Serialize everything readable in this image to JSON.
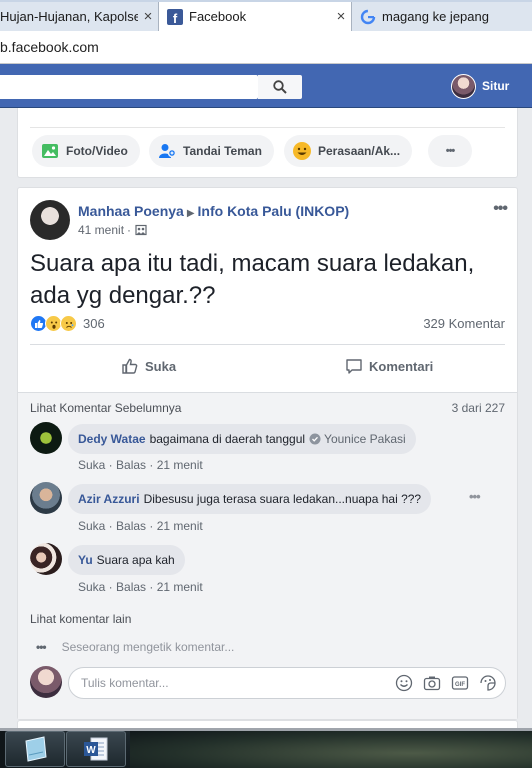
{
  "browser": {
    "tabs": [
      {
        "label": "Hujan-Hujanan, Kapolsek",
        "close": "×"
      },
      {
        "label": "Facebook",
        "close": "×"
      },
      {
        "label": "magang ke jepang",
        "close": "×"
      }
    ],
    "url": "b.facebook.com"
  },
  "header": {
    "user_name": "Situr"
  },
  "composer": {
    "actions": [
      {
        "label": "Foto/Video"
      },
      {
        "label": "Tandai Teman"
      },
      {
        "label": "Perasaan/Ak..."
      },
      {
        "label": "•••"
      }
    ]
  },
  "post": {
    "author": "Manhaa Poenya",
    "arrow": "▶",
    "group": "Info Kota Palu (INKOP)",
    "time": "41 menit",
    "separator": "·",
    "text": "Suara apa itu tadi, macam suara ledakan, ada yg dengar.??",
    "reaction_count": "306",
    "comment_count": "329 Komentar",
    "more": "•••",
    "actions": {
      "like": "Suka",
      "comment": "Komentari"
    }
  },
  "comments": {
    "prev_link": "Lihat Komentar Sebelumnya",
    "pager": "3 dari 227",
    "items": [
      {
        "name": "Dedy Watae",
        "text": "bagaimana di daerah tanggul",
        "tag": "Younice Pakasi",
        "actions": "Suka · Balas · 21 menit"
      },
      {
        "name": "Azir Azzuri",
        "text": "Dibesusu juga terasa suara ledakan...nuapa hai ???",
        "actions": "Suka · Balas · 21 menit"
      },
      {
        "name": "Yu",
        "text": "Suara apa kah",
        "actions": "Suka · Balas · 21 menit"
      }
    ],
    "comment_more": "•••",
    "more_link": "Lihat komentar lain",
    "typing_dots": "•••",
    "typing": "Seseorang mengetik komentar...",
    "placeholder": "Tulis komentar..."
  },
  "colors": {
    "fb_blue": "#4267b2",
    "link_blue": "#385898",
    "like_blue": "#2078f4"
  }
}
